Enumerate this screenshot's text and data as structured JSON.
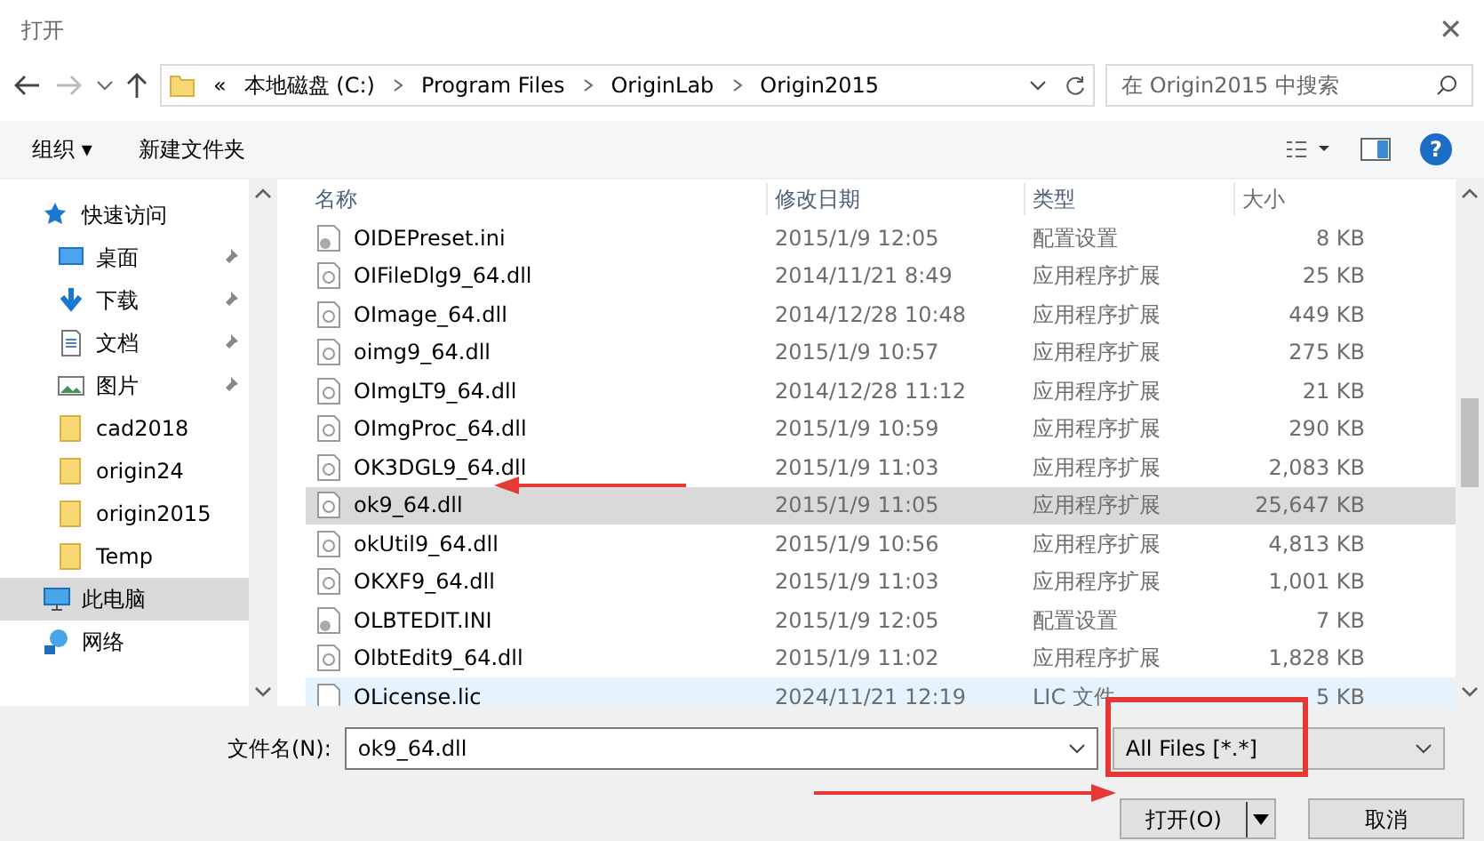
{
  "window": {
    "title": "打开",
    "close": "✕"
  },
  "address": {
    "prefix": "«",
    "crumbs": [
      "本地磁盘 (C:)",
      "Program Files",
      "OriginLab",
      "Origin2015"
    ],
    "search_placeholder": "在 Origin2015 中搜索"
  },
  "toolbar": {
    "organize": "组织 ▾",
    "new_folder": "新建文件夹",
    "help": "?"
  },
  "sidebar": {
    "items": [
      {
        "label": "快速访问",
        "kind": "star",
        "selected": false,
        "children": [
          {
            "label": "桌面",
            "kind": "desktop",
            "pinned": true,
            "selected": false
          },
          {
            "label": "下载",
            "kind": "download",
            "pinned": true,
            "selected": false
          },
          {
            "label": "文档",
            "kind": "document",
            "pinned": true,
            "selected": false
          },
          {
            "label": "图片",
            "kind": "picture",
            "pinned": true,
            "selected": false
          },
          {
            "label": "cad2018",
            "kind": "folder",
            "pinned": false,
            "selected": false
          },
          {
            "label": "origin24",
            "kind": "folder",
            "pinned": false,
            "selected": false
          },
          {
            "label": "origin2015",
            "kind": "folder",
            "pinned": false,
            "selected": false
          },
          {
            "label": "Temp",
            "kind": "folder",
            "pinned": false,
            "selected": false
          }
        ]
      },
      {
        "label": "此电脑",
        "kind": "computer",
        "selected": true
      },
      {
        "label": "网络",
        "kind": "network",
        "selected": false
      }
    ]
  },
  "table": {
    "columns": [
      "名称",
      "修改日期",
      "类型",
      "大小"
    ],
    "rows": [
      {
        "kind": "settings",
        "selected": false,
        "hovered": false,
        "cells": [
          "OIDEPreset.ini",
          "2015/1/9 12:05",
          "配置设置",
          "8 KB"
        ]
      },
      {
        "kind": "dll",
        "selected": false,
        "hovered": false,
        "cells": [
          "OIFileDlg9_64.dll",
          "2014/11/21 8:49",
          "应用程序扩展",
          "25 KB"
        ]
      },
      {
        "kind": "dll",
        "selected": false,
        "hovered": false,
        "cells": [
          "OImage_64.dll",
          "2014/12/28 10:48",
          "应用程序扩展",
          "449 KB"
        ]
      },
      {
        "kind": "dll",
        "selected": false,
        "hovered": false,
        "cells": [
          "oimg9_64.dll",
          "2015/1/9 10:57",
          "应用程序扩展",
          "275 KB"
        ]
      },
      {
        "kind": "dll",
        "selected": false,
        "hovered": false,
        "cells": [
          "OImgLT9_64.dll",
          "2014/12/28 11:12",
          "应用程序扩展",
          "21 KB"
        ]
      },
      {
        "kind": "dll",
        "selected": false,
        "hovered": false,
        "cells": [
          "OImgProc_64.dll",
          "2015/1/9 10:59",
          "应用程序扩展",
          "290 KB"
        ]
      },
      {
        "kind": "dll",
        "selected": false,
        "hovered": false,
        "cells": [
          "OK3DGL9_64.dll",
          "2015/1/9 11:03",
          "应用程序扩展",
          "2,083 KB"
        ]
      },
      {
        "kind": "dll",
        "selected": true,
        "hovered": false,
        "cells": [
          "ok9_64.dll",
          "2015/1/9 11:05",
          "应用程序扩展",
          "25,647 KB"
        ]
      },
      {
        "kind": "dll",
        "selected": false,
        "hovered": false,
        "cells": [
          "okUtil9_64.dll",
          "2015/1/9 10:56",
          "应用程序扩展",
          "4,813 KB"
        ]
      },
      {
        "kind": "dll",
        "selected": false,
        "hovered": false,
        "cells": [
          "OKXF9_64.dll",
          "2015/1/9 11:03",
          "应用程序扩展",
          "1,001 KB"
        ]
      },
      {
        "kind": "settings",
        "selected": false,
        "hovered": false,
        "cells": [
          "OLBTEDIT.INI",
          "2015/1/9 12:05",
          "配置设置",
          "7 KB"
        ]
      },
      {
        "kind": "dll",
        "selected": false,
        "hovered": false,
        "cells": [
          "OlbtEdit9_64.dll",
          "2015/1/9 11:02",
          "应用程序扩展",
          "1,828 KB"
        ]
      },
      {
        "kind": "file",
        "selected": false,
        "hovered": true,
        "cells": [
          "OLicense.lic",
          "2024/11/21 12:19",
          "LIC 文件",
          "5 KB"
        ]
      }
    ]
  },
  "footer": {
    "filename_label": "文件名(N):",
    "filename": "ok9_64.dll",
    "filter": "All Files [*.*]",
    "open": "打开(O)",
    "cancel": "取消"
  }
}
